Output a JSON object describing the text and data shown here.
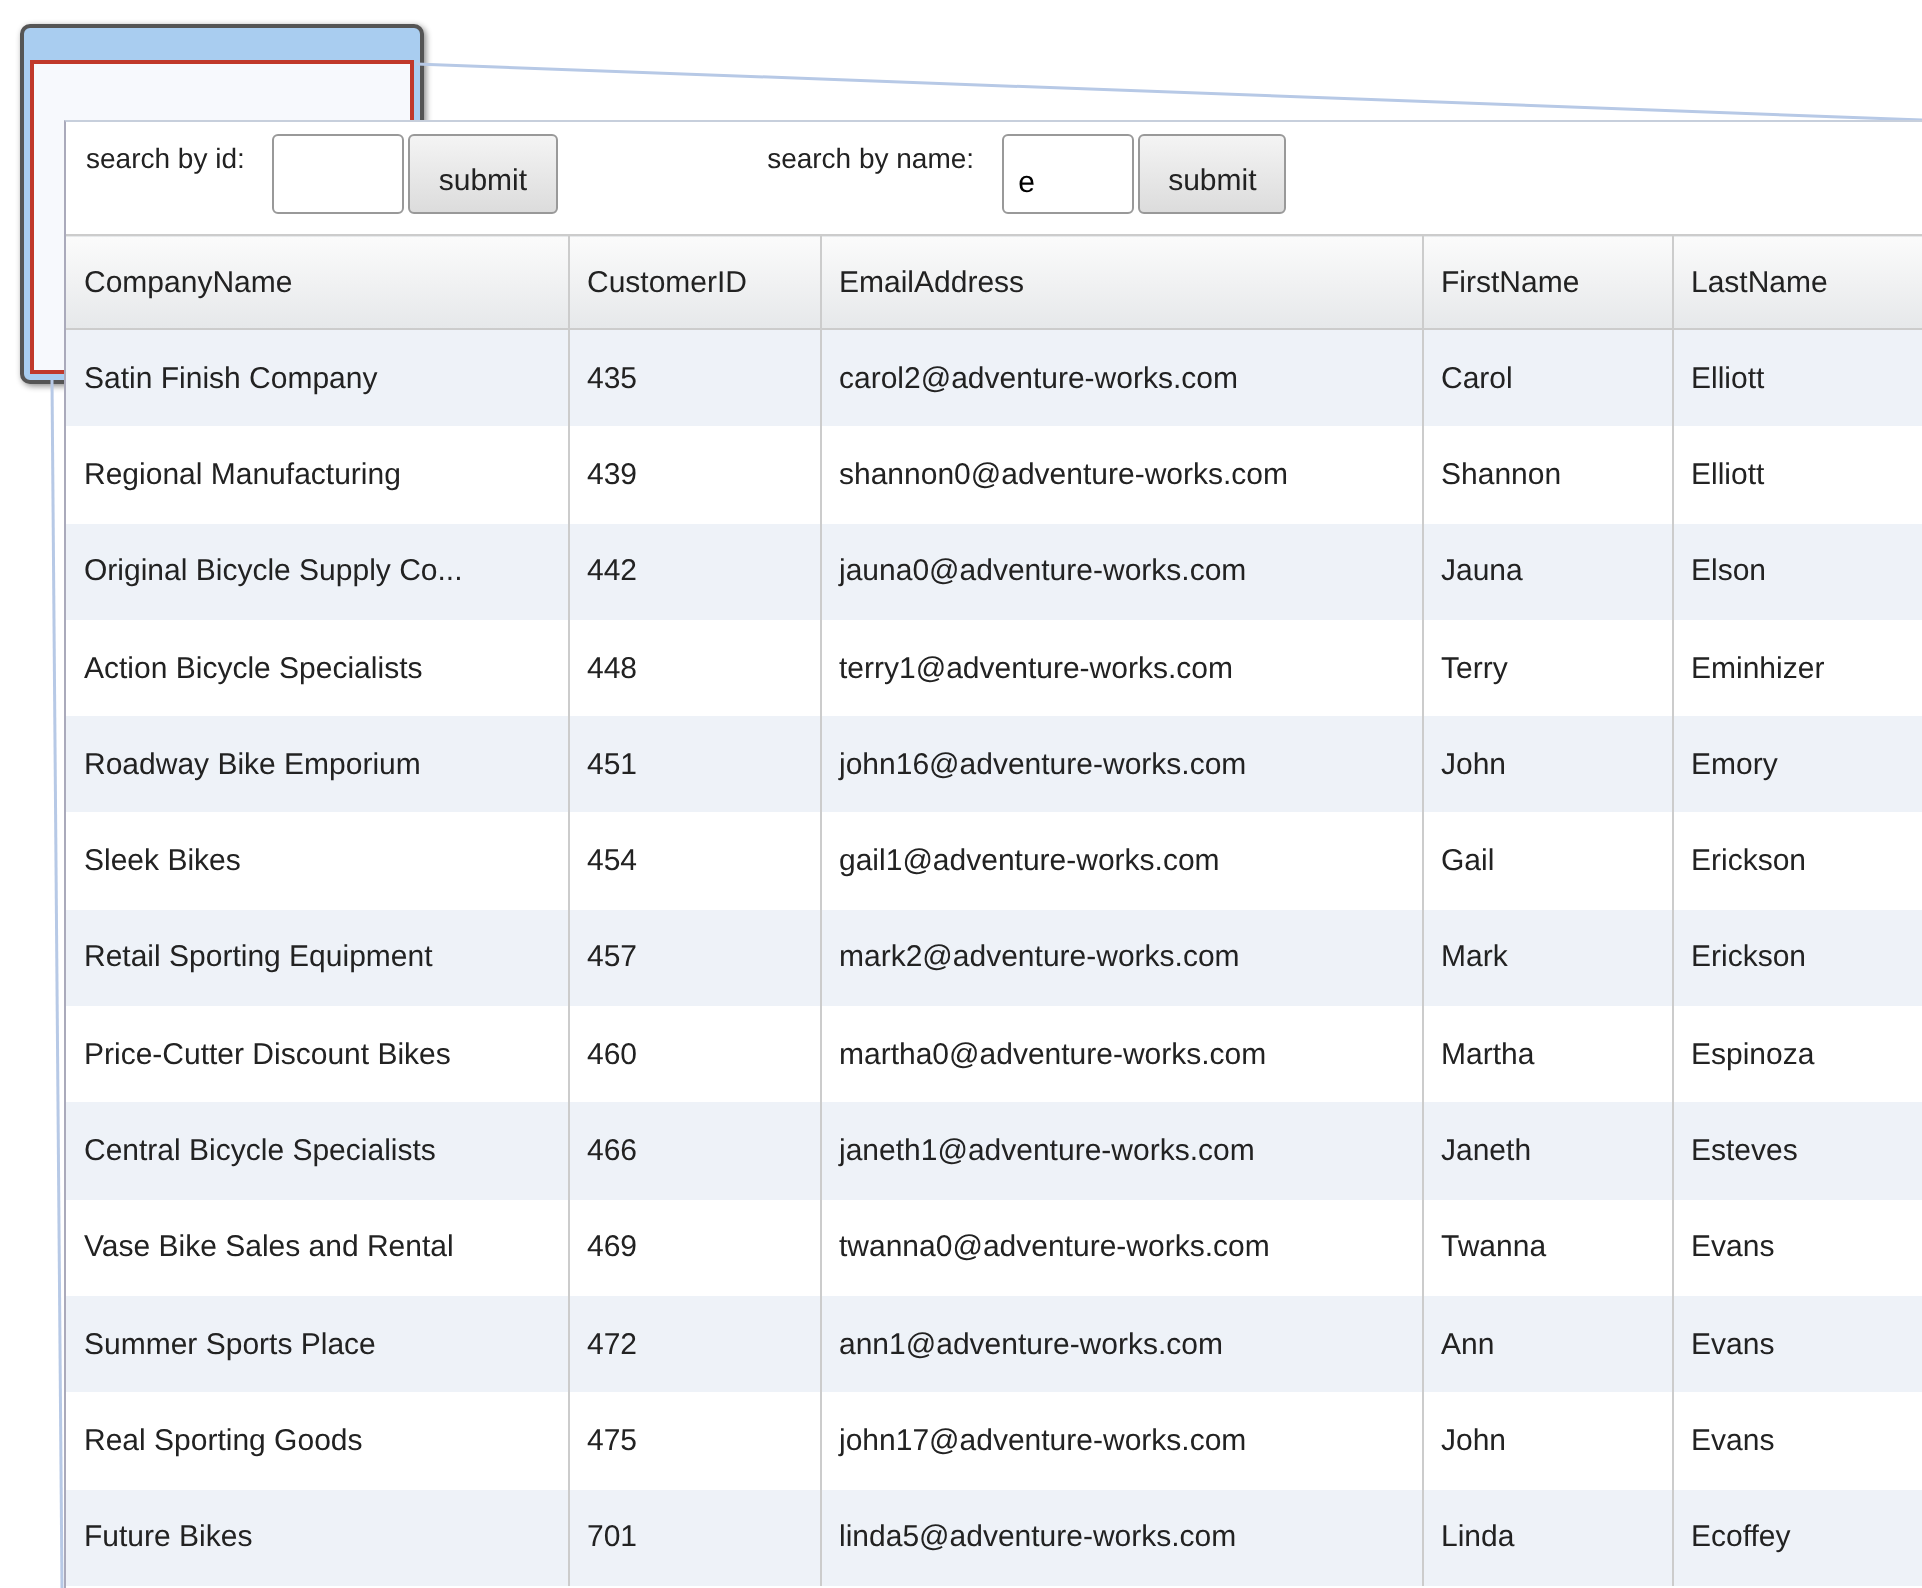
{
  "searches": [
    {
      "label": "search by id:",
      "button": "submit"
    },
    {
      "label": "search by name:",
      "value": "e",
      "button": "submit"
    }
  ],
  "table": {
    "columns": [
      "CompanyName",
      "CustomerID",
      "EmailAddress",
      "FirstName",
      "LastName"
    ],
    "rows": [
      [
        "Satin Finish Company",
        "435",
        "carol2@adventure-works.com",
        "Carol",
        "Elliott"
      ],
      [
        "Regional Manufacturing",
        "439",
        "shannon0@adventure-works.com",
        "Shannon",
        "Elliott"
      ],
      [
        "Original Bicycle Supply Co...",
        "442",
        "jauna0@adventure-works.com",
        "Jauna",
        "Elson"
      ],
      [
        "Action Bicycle Specialists",
        "448",
        "terry1@adventure-works.com",
        "Terry",
        "Eminhizer"
      ],
      [
        "Roadway Bike Emporium",
        "451",
        "john16@adventure-works.com",
        "John",
        "Emory"
      ],
      [
        "Sleek Bikes",
        "454",
        "gail1@adventure-works.com",
        "Gail",
        "Erickson"
      ],
      [
        "Retail Sporting Equipment",
        "457",
        "mark2@adventure-works.com",
        "Mark",
        "Erickson"
      ],
      [
        "Price-Cutter Discount Bikes",
        "460",
        "martha0@adventure-works.com",
        "Martha",
        "Espinoza"
      ],
      [
        "Central Bicycle Specialists",
        "466",
        "janeth1@adventure-works.com",
        "Janeth",
        "Esteves"
      ],
      [
        "Vase Bike Sales and Rental",
        "469",
        "twanna0@adventure-works.com",
        "Twanna",
        "Evans"
      ],
      [
        "Summer Sports Place",
        "472",
        "ann1@adventure-works.com",
        "Ann",
        "Evans"
      ],
      [
        "Real Sporting Goods",
        "475",
        "john17@adventure-works.com",
        "John",
        "Evans"
      ],
      [
        "Future Bikes",
        "701",
        "linda5@adventure-works.com",
        "Linda",
        "Ecoffey"
      ]
    ]
  }
}
